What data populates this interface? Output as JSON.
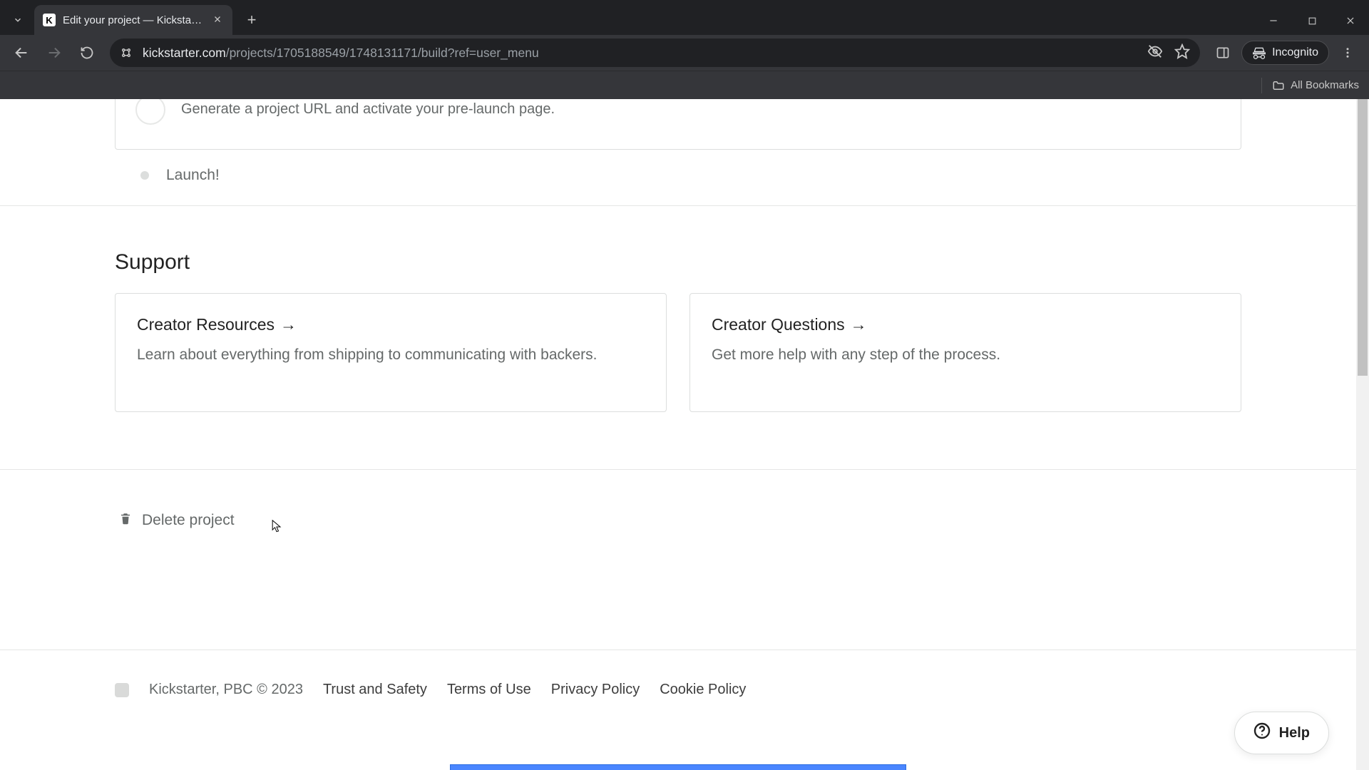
{
  "browser": {
    "tab_title": "Edit your project — Kickstarter",
    "favicon_letter": "K",
    "url_host": "kickstarter.com",
    "url_path": "/projects/1705188549/1748131171/build?ref=user_menu",
    "incognito_label": "Incognito",
    "all_bookmarks_label": "All Bookmarks"
  },
  "top_stub": {
    "description": "Generate a project URL and activate your pre-launch page."
  },
  "launch_label": "Launch!",
  "support": {
    "heading": "Support",
    "cards": [
      {
        "title": "Creator Resources",
        "desc": "Learn about everything from shipping to communicating with backers."
      },
      {
        "title": "Creator Questions",
        "desc": "Get more help with any step of the process."
      }
    ]
  },
  "delete_label": "Delete project",
  "footer": {
    "copyright": "Kickstarter, PBC © 2023",
    "links": [
      "Trust and Safety",
      "Terms of Use",
      "Privacy Policy",
      "Cookie Policy"
    ]
  },
  "help_label": "Help"
}
